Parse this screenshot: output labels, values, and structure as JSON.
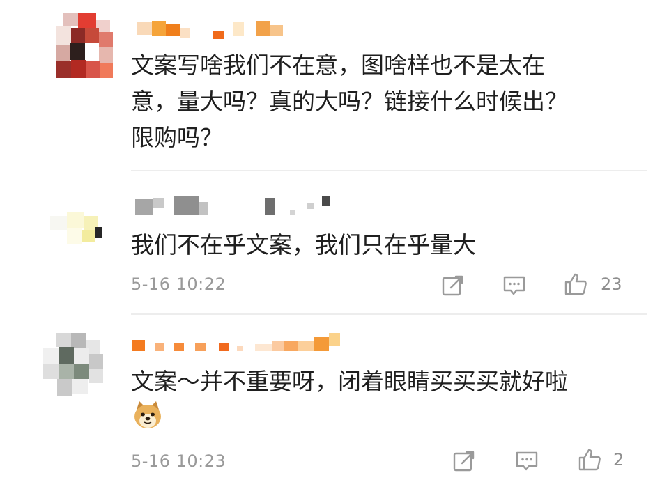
{
  "comments": [
    {
      "text": "文案写啥我们不在意，图啥样也不是太在\n意，量大吗？真的大吗？链接什么时候出？\n限购吗？"
    },
    {
      "text": "我们不在乎文案，我们只在乎量大",
      "time": "5-16 10:22",
      "likes": "23"
    },
    {
      "text": "文案～并不重要呀，闭着眼睛买买买就好啦",
      "time": "5-16 10:23",
      "likes": "2",
      "emoji": "doge-emoji"
    }
  ],
  "colors": {
    "text": "#1f1f1f",
    "meta": "#9a9a9a",
    "divider": "#ededed",
    "mosaic_orange": "#f5a623"
  },
  "icons": [
    "share-icon",
    "comment-icon",
    "like-icon"
  ]
}
